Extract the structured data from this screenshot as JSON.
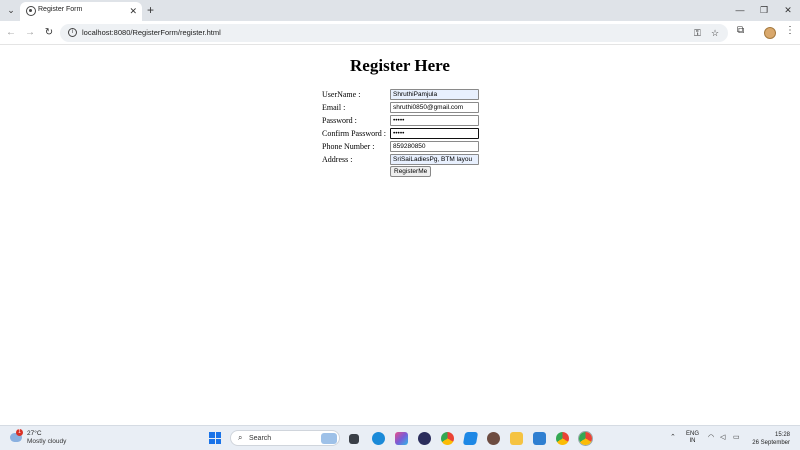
{
  "browser": {
    "tab_title": "Register Form",
    "url": "localhost:8080/RegisterForm/register.html"
  },
  "page": {
    "heading": "Register Here",
    "fields": [
      {
        "label": "UserName :",
        "value": "ShruthiPamjula"
      },
      {
        "label": "Email :",
        "value": "shruthi0850@gmail.com"
      },
      {
        "label": "Password :",
        "value": "•••••"
      },
      {
        "label": "Confirm Password :",
        "value": "•••••"
      },
      {
        "label": "Phone Number :",
        "value": "859280850"
      },
      {
        "label": "Address :",
        "value": "SriSaiLadiesPg, BTM layou"
      }
    ],
    "submit_label": "RegisterMe"
  },
  "taskbar": {
    "weather_temp": "27°C",
    "weather_desc": "Mostly cloudy",
    "weather_badge": "1",
    "search_placeholder": "Search",
    "lang_line1": "ENG",
    "lang_line2": "IN",
    "time": "15:28",
    "date": "26 September"
  },
  "colors": {
    "autofill_bg": "#e8f0fe",
    "accent": "#1a73e8"
  }
}
